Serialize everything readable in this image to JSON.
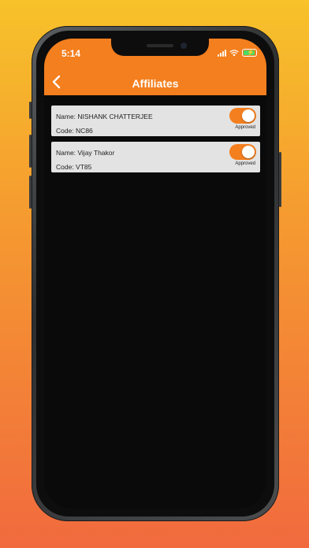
{
  "status_bar": {
    "time": "5:14"
  },
  "header": {
    "title": "Affiliates"
  },
  "affiliates": [
    {
      "name": "Name: NISHANK CHATTERJEE",
      "code": "Code: NC86",
      "status": "Approved",
      "enabled": true
    },
    {
      "name": "Name: Vijay Thakor",
      "code": "Code: VT85",
      "status": "Approved",
      "enabled": true
    }
  ],
  "colors": {
    "accent": "#f47f1e",
    "card": "#e3e3e3",
    "background": "#0a0a0a"
  }
}
